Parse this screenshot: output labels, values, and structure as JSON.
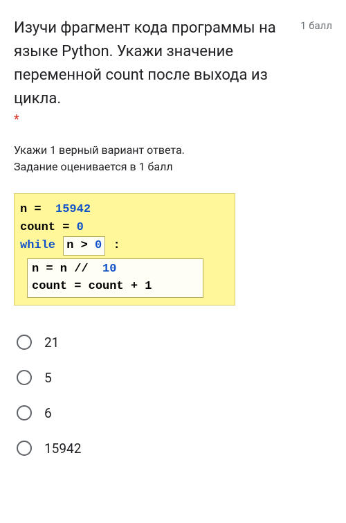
{
  "question": {
    "title": "Изучи фрагмент кода программы на языке Python. Укажи значение переменной count после выхода из цикла.",
    "points": "1 балл",
    "required": "*",
    "hint_line1": "Укажи 1 верный вариант ответа.",
    "hint_line2": "Задание оценивается в 1 балл"
  },
  "code": {
    "line1_var": "n",
    "line1_eq": " = ",
    "line1_val": " 15942",
    "line2_var": "count",
    "line2_eq": " = ",
    "line2_val": "0",
    "line3_kw": "while",
    "line3_cond_left": "n ",
    "line3_cond_op": ">",
    "line3_cond_right": " 0",
    "line3_colon": ":",
    "inner1_left": "n = n // ",
    "inner1_val": " 10",
    "inner2": "count = count + 1"
  },
  "options": [
    {
      "label": "21"
    },
    {
      "label": "5"
    },
    {
      "label": "6"
    },
    {
      "label": "15942"
    }
  ]
}
